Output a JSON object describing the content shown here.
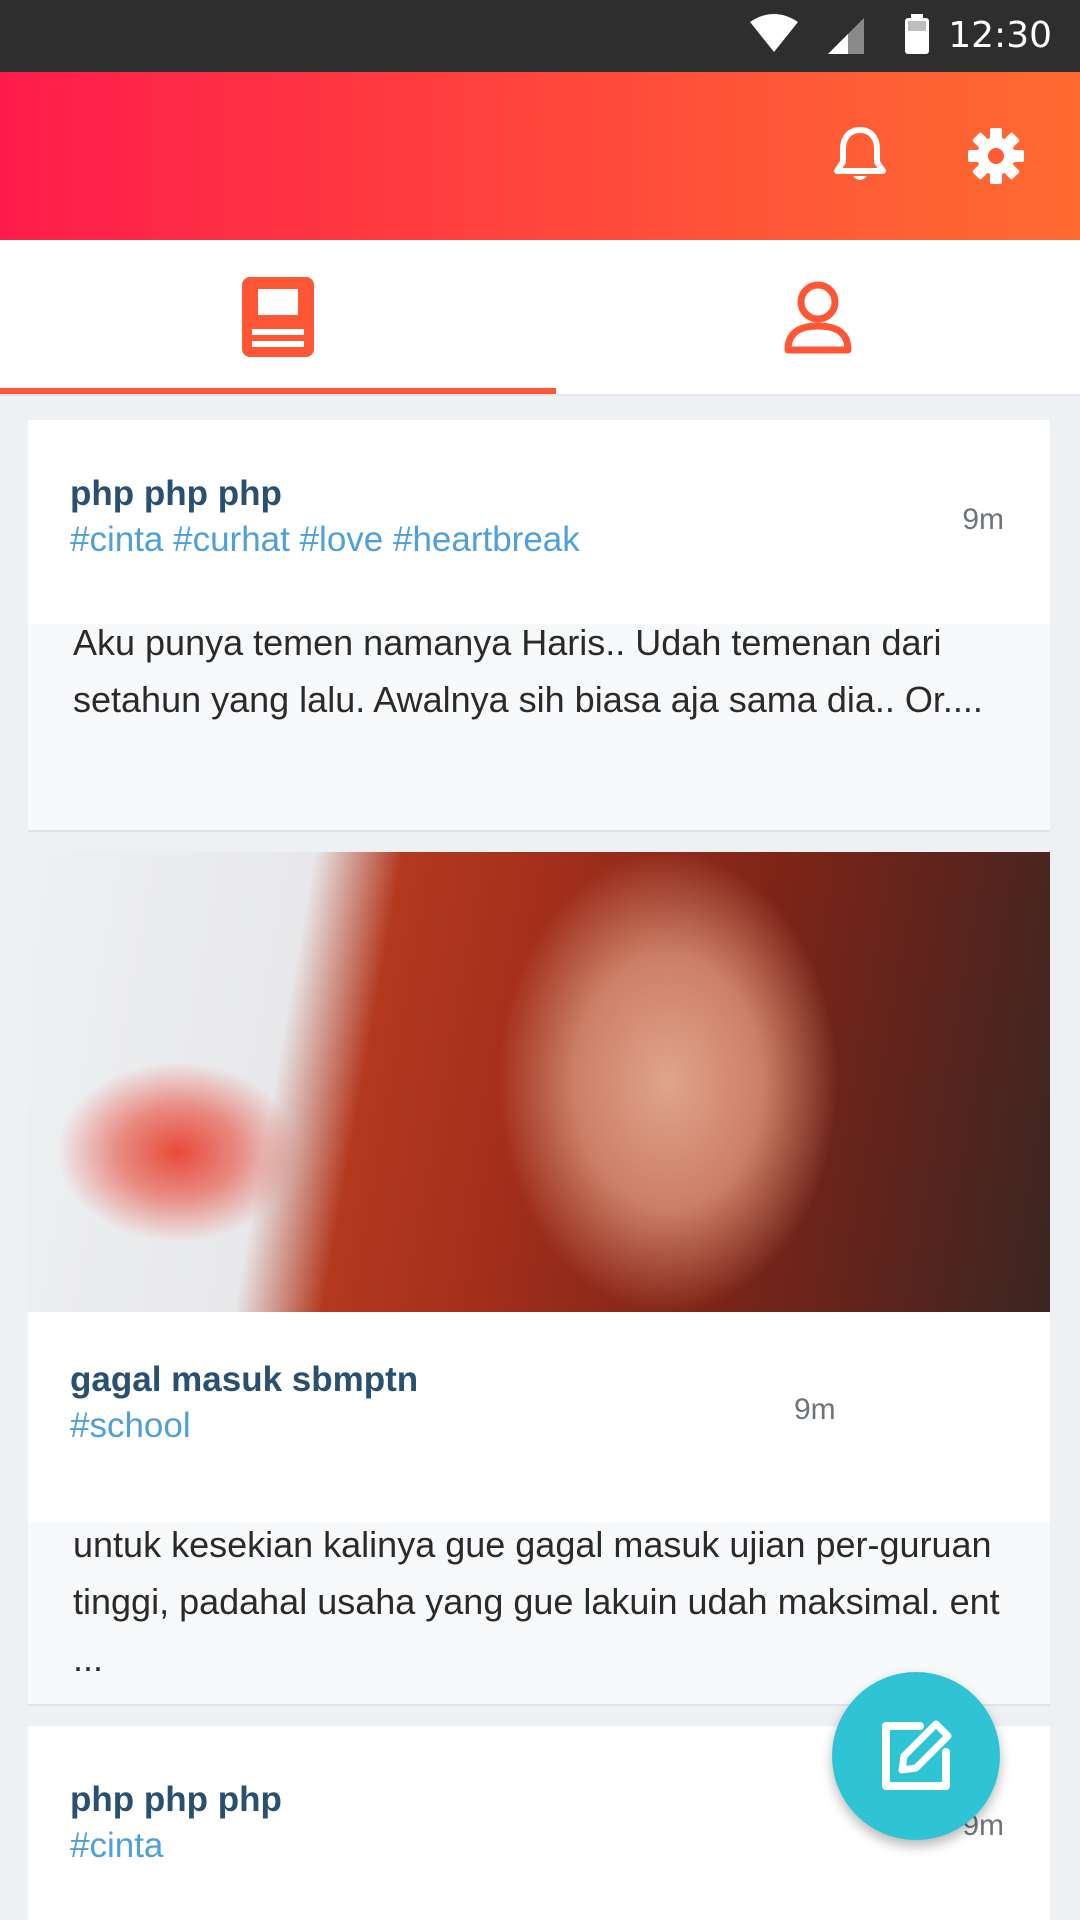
{
  "status_bar": {
    "time": "12:30",
    "icons": [
      "wifi-icon",
      "cell-signal-icon",
      "battery-icon"
    ]
  },
  "app_bar": {
    "actions": [
      {
        "icon": "bell-icon",
        "label": "notifications"
      },
      {
        "icon": "gear-icon",
        "label": "settings"
      }
    ],
    "gradient": [
      "#ff1c4c",
      "#ff6a30"
    ]
  },
  "tabs": [
    {
      "icon": "book-icon",
      "selected": true
    },
    {
      "icon": "person-icon",
      "selected": false
    }
  ],
  "posts": [
    {
      "title": "php php php",
      "tags": "#cinta #curhat #love #heartbreak",
      "time": "9m",
      "excerpt": "Aku punya temen namanya Haris.. Udah temenan dari setahun yang lalu. Awalnya sih biasa aja sama dia.. Or...."
    },
    {
      "has_image": true,
      "title": "gagal masuk sbmptn",
      "tags": "#school",
      "time": "9m",
      "excerpt": "untuk kesekian kalinya gue gagal masuk ujian per-guruan tinggi, padahal usaha yang gue lakuin udah maksimal. ent ..."
    },
    {
      "title": "php php php",
      "tags": "#cinta",
      "time": "9m"
    }
  ],
  "fab": {
    "icon": "compose-icon"
  },
  "colors": {
    "accent": "#ff5735",
    "title": "#29506f",
    "tag": "#4fa0d8",
    "fab": "#2fc3d6"
  }
}
